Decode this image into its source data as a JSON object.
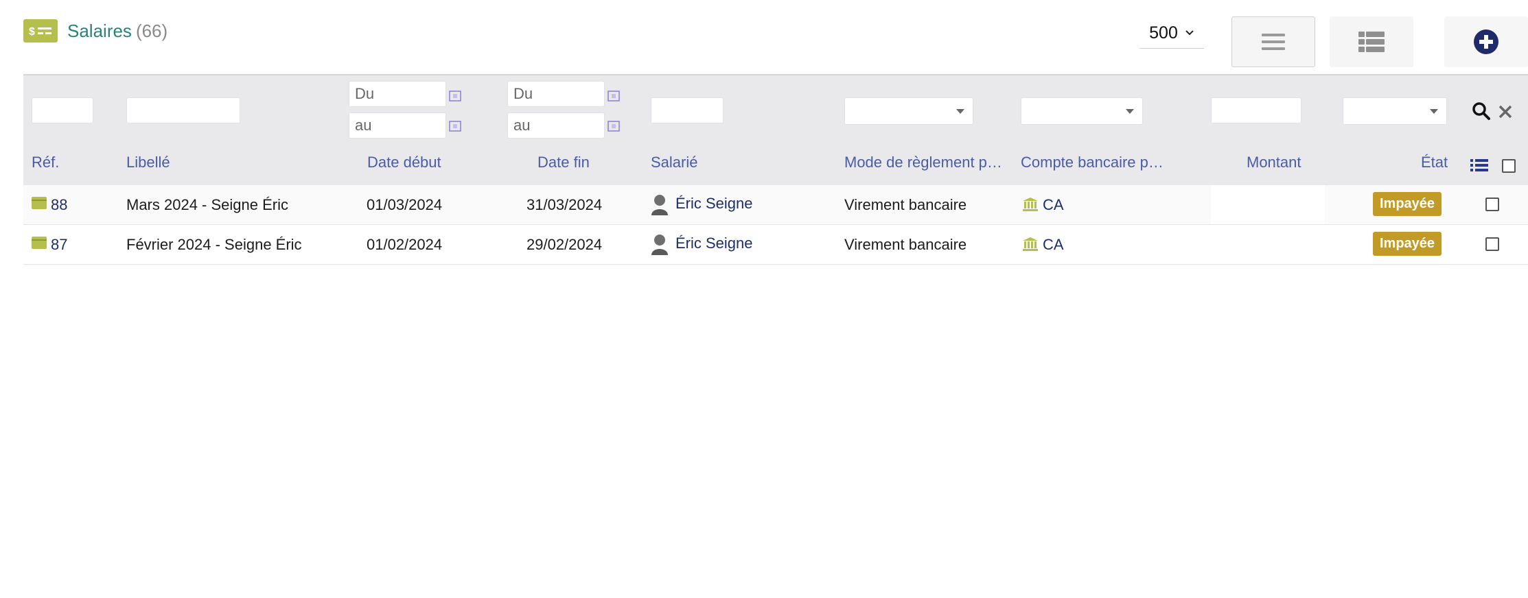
{
  "header": {
    "title": "Salaires",
    "count": "(66)",
    "limit": "500"
  },
  "filters": {
    "date_debut": {
      "from_placeholder": "Du",
      "to_placeholder": "au"
    },
    "date_fin": {
      "from_placeholder": "Du",
      "to_placeholder": "au"
    }
  },
  "columns": {
    "ref": "Réf.",
    "libelle": "Libellé",
    "date_debut": "Date début",
    "date_fin": "Date fin",
    "salarie": "Salarié",
    "mode": "Mode de règlement p…",
    "compte": "Compte bancaire p…",
    "montant": "Montant",
    "etat": "État"
  },
  "rows": [
    {
      "ref": "88",
      "libelle": "Mars 2024 - Seigne Éric",
      "date_debut": "01/03/2024",
      "date_fin": "31/03/2024",
      "salarie": "Éric Seigne",
      "mode": "Virement bancaire",
      "compte": "CA",
      "etat": "Impayée"
    },
    {
      "ref": "87",
      "libelle": "Février 2024 - Seigne Éric",
      "date_debut": "01/02/2024",
      "date_fin": "29/02/2024",
      "salarie": "Éric Seigne",
      "mode": "Virement bancaire",
      "compte": "CA",
      "etat": "Impayée"
    }
  ],
  "colors": {
    "accent_title": "#28837c",
    "header_text": "#4a5ba8",
    "badge": "#c29a26",
    "icon_green": "#b5c04c",
    "link": "#1f2d6b"
  },
  "icons": [
    "salary-icon",
    "chevron-down-icon",
    "list-view-icon",
    "kanban-view-icon",
    "plus-circle-icon",
    "calendar-icon",
    "search-icon",
    "close-icon",
    "wallet-icon",
    "user-icon",
    "bank-icon",
    "column-list-icon"
  ]
}
